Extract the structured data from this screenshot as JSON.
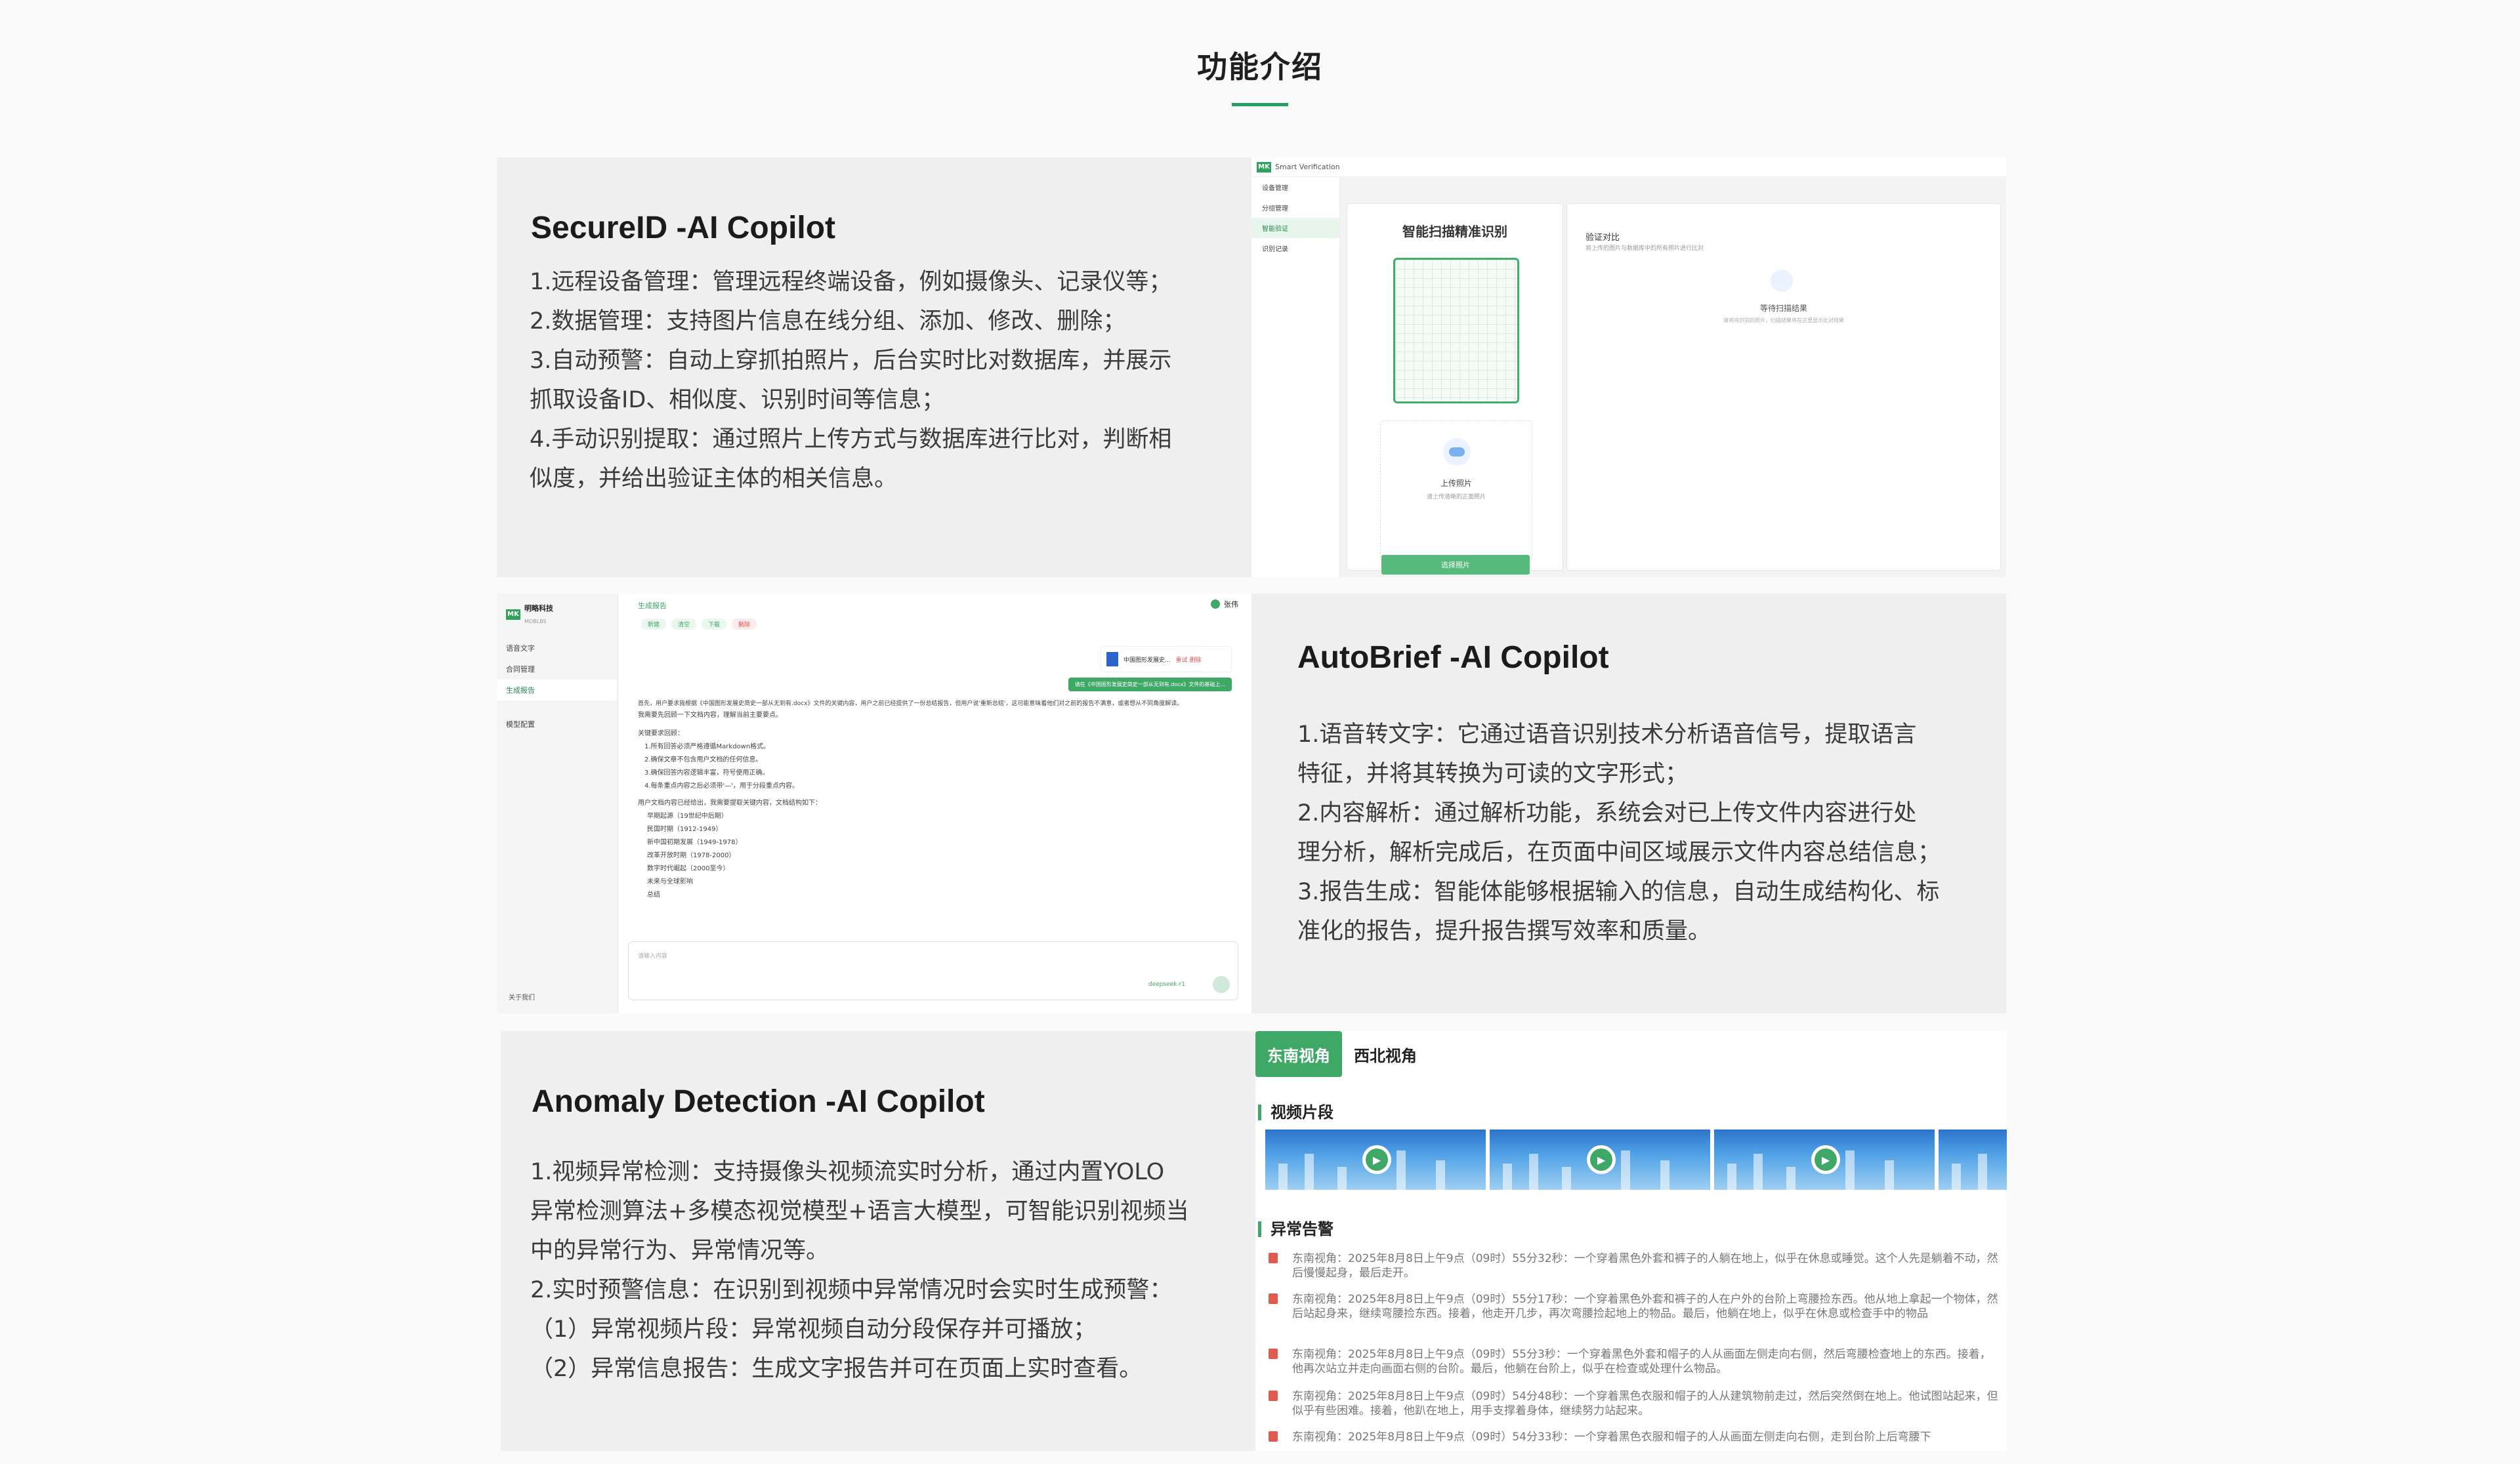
{
  "page_title": "功能介绍",
  "sections": [
    {
      "title": "SecureID -AI Copilot",
      "lines": [
        "1.远程设备管理：管理远程终端设备，例如摄像头、记录仪等；",
        "2.数据管理：支持图片信息在线分组、添加、修改、删除；",
        "3.自动预警：自动上穿抓拍照片，后台实时比对数据库，并展示",
        "抓取设备ID、相似度、识别时间等信息；",
        "4.手动识别提取：通过照片上传方式与数据库进行比对，判断相",
        "似度，并给出验证主体的相关信息。"
      ]
    },
    {
      "title": "AutoBrief -AI Copilot",
      "lines": [
        "1.语音转文字：它通过语音识别技术分析语音信号，提取语言",
        "特征，并将其转换为可读的文字形式；",
        "2.内容解析：通过解析功能，系统会对已上传文件内容进行处",
        "理分析，解析完成后，在页面中间区域展示文件内容总结信息；",
        "3.报告生成：智能体能够根据输入的信息，自动生成结构化、标",
        "准化的报告，提升报告撰写效率和质量。"
      ]
    },
    {
      "title": "Anomaly Detection -AI Copilot",
      "lines": [
        "1.视频异常检测：支持摄像头视频流实时分析，通过内置YOLO",
        "异常检测算法+多模态视觉模型+语言大模型，可智能识别视频当",
        "中的异常行为、异常情况等。",
        "2.实时预警信息：在识别到视频中异常情况时会实时生成预警：",
        "（1）异常视频片段：异常视频自动分段保存并可播放；",
        "（2）异常信息报告：生成文字报告并可在页面上实时查看。"
      ]
    }
  ],
  "shot1": {
    "app_name": "Smart Verification",
    "menu": [
      "设备管理",
      "分组管理",
      "智能验证",
      "识别记录"
    ],
    "scan_title": "智能扫描精准识别",
    "upload_label": "上传照片",
    "upload_hint": "请上传清晰的正面照片",
    "upload_button": "选择照片",
    "verify_title": "验证对比",
    "verify_sub": "将上传的图片与数据库中的所有照片进行比对",
    "waiting": "等待扫描结果",
    "waiting_hint": "请将待识别的照片，扫描结果将在这里显示比对结果"
  },
  "shot2": {
    "brand": "明略科技",
    "brand_en": "MOBLBS",
    "menu": [
      "语音文字",
      "合同管理",
      "生成报告",
      "模型配置"
    ],
    "footer": "关于我们",
    "tab": "生成报告",
    "user": "张伟",
    "chips": [
      "新建",
      "清空",
      "下载",
      "删除"
    ],
    "file_name": "中国图形发展史...",
    "file_actions": "重试  删除",
    "prompt": "请在《中国图形发展史简史一部从无到有.docx》文件的基础上...",
    "summary": [
      "首先，用户要求我根据《中国图形发展史简史一部从无到有.docx》文件的关键内容，用户之前已经提供了一份总结报告，但用户说'重新总结'，这可能意味着他们对之前的报告不满意，或者想从不同角度解读。",
      "我需要先回顾一下文档内容，理解当前主要要点。"
    ],
    "req_title": "关键要求回顾：",
    "reqs": [
      "1.所有回答必须严格遵循Markdown格式。",
      "2.确保文章不包含用户文档的任何信息。",
      "3.确保回答内容逻辑丰富，符号使用正确。",
      "4.每条重点内容之后必须带'—'，用于分段重点内容。"
    ],
    "list_title": "用户文档内容已经给出，我需要提取关键内容，文档结构如下：",
    "list": [
      "早期起源（19世纪中后期）",
      "民国时期（1912-1949）",
      "新中国初期发展（1949-1978）",
      "改革开放时期（1978-2000）",
      "数字时代崛起（2000至今）",
      "未来与全球影响",
      "总结"
    ],
    "input_placeholder": "请输入内容",
    "model": "deepseek-r1"
  },
  "shot3": {
    "tabs": [
      "东南视角",
      "西北视角"
    ],
    "video_section": "视频片段",
    "alert_section": "异常告警",
    "alerts": [
      "东南视角：2025年8月8日上午9点（09时）55分32秒：一个穿着黑色外套和裤子的人躺在地上，似乎在休息或睡觉。这个人先是躺着不动，然后慢慢起身，最后走开。",
      "东南视角：2025年8月8日上午9点（09时）55分17秒：一个穿着黑色外套和裤子的人在户外的台阶上弯腰捡东西。他从地上拿起一个物体，然后站起身来，继续弯腰捡东西。接着，他走开几步，再次弯腰捡起地上的物品。最后，他躺在地上，似乎在休息或检查手中的物品",
      "东南视角：2025年8月8日上午9点（09时）55分3秒：一个穿着黑色外套和帽子的人从画面左侧走向右侧，然后弯腰检查地上的东西。接着，他再次站立并走向画面右侧的台阶。最后，他躺在台阶上，似乎在检查或处理什么物品。",
      "东南视角：2025年8月8日上午9点（09时）54分48秒：一个穿着黑色衣服和帽子的人从建筑物前走过，然后突然倒在地上。他试图站起来，但似乎有些困难。接着，他趴在地上，用手支撑着身体，继续努力站起来。",
      "东南视角：2025年8月8日上午9点（09时）54分33秒：一个穿着黑色衣服和帽子的人从画面左侧走向右侧，走到台阶上后弯腰下"
    ]
  },
  "colors": {
    "accent": "#3fa867",
    "panel": "#efefef",
    "background": "#fafafa"
  }
}
